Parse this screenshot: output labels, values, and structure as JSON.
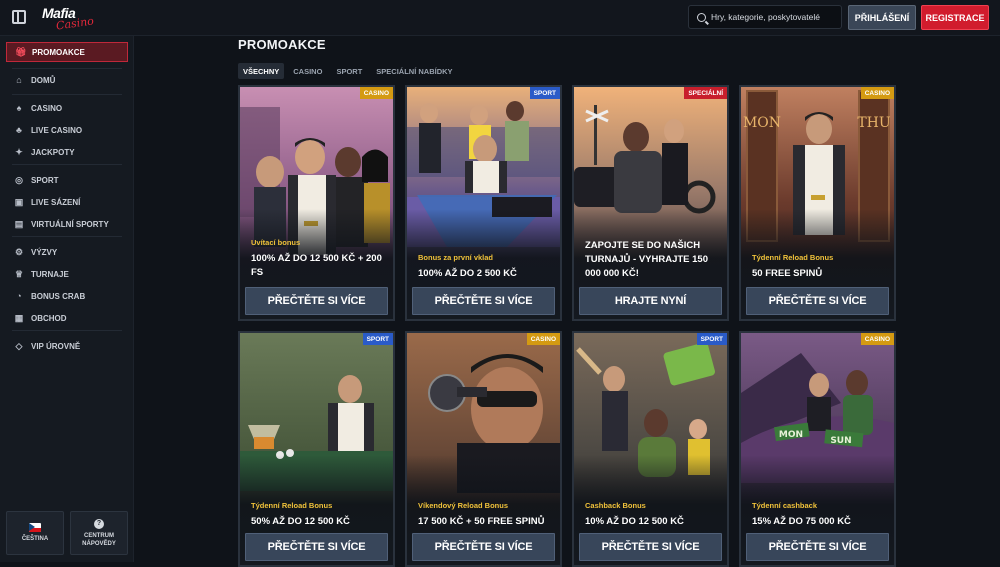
{
  "header": {
    "logo_main": "Mafia",
    "logo_sub": "Casino",
    "search_placeholder": "Hry, kategorie, poskytovatelé",
    "login_label": "PŘIHLÁŠENÍ",
    "register_label": "REGISTRACE"
  },
  "sidebar": {
    "items": [
      {
        "label": "PROMOAKCE",
        "icon": "gift-icon",
        "active": true
      },
      {
        "label": "DOMŮ",
        "icon": "home-icon"
      },
      {
        "label": "CASINO",
        "icon": "spade-icon"
      },
      {
        "label": "LIVE CASINO",
        "icon": "live-cards-icon"
      },
      {
        "label": "JACKPOTY",
        "icon": "jackpot-icon"
      },
      {
        "label": "SPORT",
        "icon": "soccer-ball-icon"
      },
      {
        "label": "LIVE SÁZENÍ",
        "icon": "live-betting-icon"
      },
      {
        "label": "VIRTUÁLNÍ SPORTY",
        "icon": "virtual-sports-icon"
      },
      {
        "label": "VÝZVY",
        "icon": "challenge-icon"
      },
      {
        "label": "TURNAJE",
        "icon": "trophy-icon"
      },
      {
        "label": "BONUS CRAB",
        "icon": "bonus-crab-icon"
      },
      {
        "label": "OBCHOD",
        "icon": "shop-icon"
      },
      {
        "label": "VIP ÚROVNĚ",
        "icon": "diamond-icon"
      }
    ],
    "footer": {
      "language_label": "ČEŠTINA",
      "help_label_1": "CENTRUM",
      "help_label_2": "NÁPOVĚDY"
    }
  },
  "main": {
    "title": "PROMOAKCE",
    "tabs": [
      {
        "label": "VŠECHNY",
        "active": true
      },
      {
        "label": "CASINO"
      },
      {
        "label": "SPORT"
      },
      {
        "label": "SPECIÁLNÍ NABÍDKY"
      }
    ],
    "cards": [
      {
        "badge": "CASINO",
        "badge_type": "casino",
        "subtitle": "Uvítací bonus",
        "title": "100% AŽ DO 12 500 KČ + 200 FS",
        "button": "PŘEČTĚTE SI VÍCE"
      },
      {
        "badge": "SPORT",
        "badge_type": "sport",
        "subtitle": "Bonus za první vklad",
        "title": "100% AŽ DO 2 500 KČ",
        "button": "PŘEČTĚTE SI VÍCE"
      },
      {
        "badge": "SPECIÁLNÍ",
        "badge_type": "special",
        "subtitle": "",
        "title": "ZAPOJTE SE DO NAŠICH TURNAJŮ - VYHRAJTE 150 000 000 KČ!",
        "button": "HRAJTE NYNÍ"
      },
      {
        "badge": "CASINO",
        "badge_type": "casino",
        "subtitle": "Týdenní Reload Bonus",
        "title": "50 FREE SPINŮ",
        "button": "PŘEČTĚTE SI VÍCE"
      },
      {
        "badge": "SPORT",
        "badge_type": "sport",
        "subtitle": "Týdenní Reload Bonus",
        "title": "50% AŽ DO 12 500 KČ",
        "button": "PŘEČTĚTE SI VÍCE"
      },
      {
        "badge": "CASINO",
        "badge_type": "casino",
        "subtitle": "Víkendový Reload Bonus",
        "title": "17 500 KČ + 50 FREE SPINŮ",
        "button": "PŘEČTĚTE SI VÍCE"
      },
      {
        "badge": "SPORT",
        "badge_type": "sport",
        "subtitle": "Cashback Bonus",
        "title": "10% AŽ DO 12 500 KČ",
        "button": "PŘEČTĚTE SI VÍCE"
      },
      {
        "badge": "CASINO",
        "badge_type": "casino",
        "subtitle": "Týdenní cashback",
        "title": "15% AŽ DO 75 000 KČ",
        "button": "PŘEČTĚTE SI VÍCE"
      }
    ],
    "art_signs": {
      "mon": "MON",
      "thu": "THU",
      "sun": "SUN"
    }
  },
  "colors": {
    "accent_red": "#d11c2d",
    "badge_casino": "#d49a12",
    "badge_sport": "#2a5bc8",
    "badge_special": "#c81f2c",
    "subtitle_gold": "#f0c23a"
  }
}
